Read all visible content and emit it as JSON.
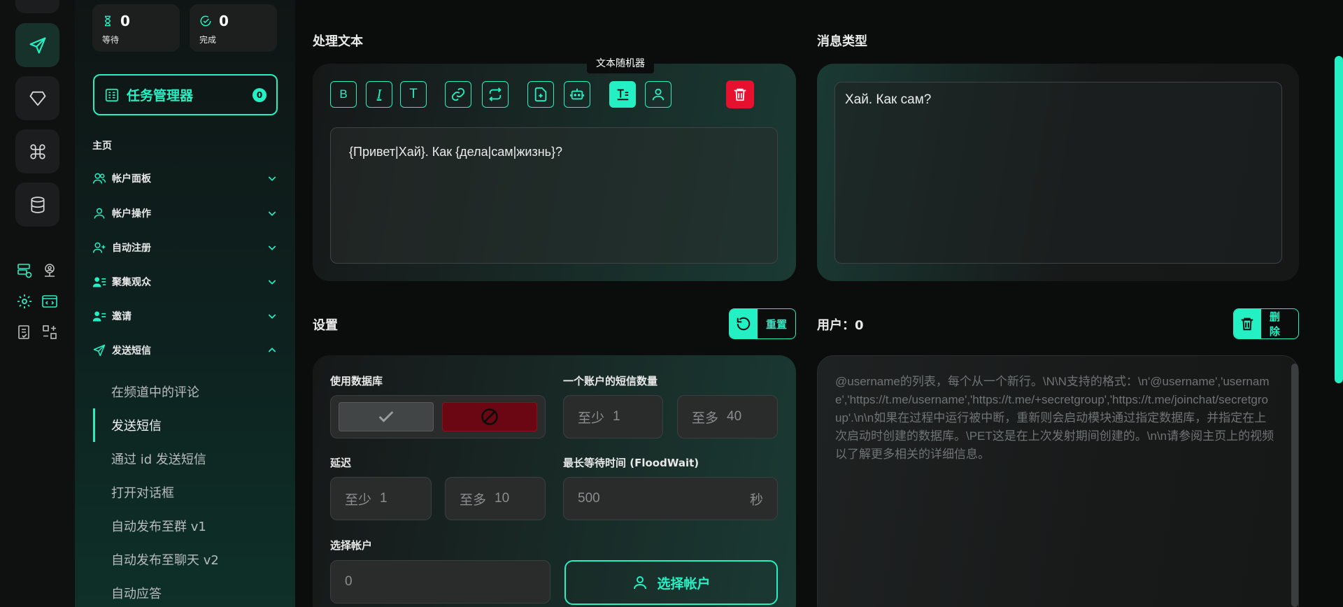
{
  "rail": {
    "icons": [
      "send-icon",
      "diamond-icon",
      "command-icon",
      "database-icon"
    ]
  },
  "stats": {
    "waiting_count": "0",
    "waiting_label": "等待",
    "done_count": "0",
    "done_label": "完成"
  },
  "task_manager": {
    "label": "任务管理器",
    "count": "0"
  },
  "nav": {
    "home": "主页",
    "items": [
      {
        "label": "帐户面板"
      },
      {
        "label": "帐户操作"
      },
      {
        "label": "自动注册"
      },
      {
        "label": "聚集观众"
      },
      {
        "label": "邀请"
      },
      {
        "label": "发送短信"
      }
    ],
    "sub_items": [
      {
        "label": "在频道中的评论"
      },
      {
        "label": "发送短信"
      },
      {
        "label": "通过 id 发送短信"
      },
      {
        "label": "打开对话框"
      },
      {
        "label": "自动发布至群 v1"
      },
      {
        "label": "自动发布至聊天 v2"
      },
      {
        "label": "自动应答"
      }
    ]
  },
  "process_text": {
    "title": "处理文本",
    "tooltip": "文本随机器",
    "content": "{Привет|Хай}. Как {дела|сам|жизнь}?"
  },
  "message_type": {
    "title": "消息类型",
    "content": "Хай. Как сам?"
  },
  "settings": {
    "title": "设置",
    "reset_label": "重置",
    "use_db_label": "使用数据库",
    "sms_count_label": "一个账户的短信数量",
    "sms_min_placeholder": "至少",
    "sms_min_value": "1",
    "sms_max_placeholder": "至多",
    "sms_max_value": "40",
    "delay_label": "延迟",
    "delay_min_placeholder": "至少",
    "delay_min_value": "1",
    "delay_max_placeholder": "至多",
    "delay_max_value": "10",
    "floodwait_label": "最长等待时间 (FloodWait)",
    "floodwait_value": "500",
    "floodwait_unit": "秒",
    "select_account_label": "选择帐户",
    "select_account_value": "0",
    "select_account_button": "选择帐户"
  },
  "users": {
    "title": "用户：0",
    "delete_label": "删除",
    "placeholder": "@username的列表，每个从一个新行。\\N\\N支持的格式：\\n'@username','username','https://t.me/username','https://t.me/+secretgroup','https://t.me/joinchat/secretgroup'.\\n\\n如果在过程中运行被中断，重新则会启动模块通过指定数据库，并指定在上次启动时创建的数据库。\\PET这是在上次发射期间创建的。\\n\\n请参阅主页上的视频以了解更多相关的详细信息。"
  },
  "colors": {
    "accent": "#25f0c4",
    "danger": "#e5112f",
    "background": "#0b0c0c"
  }
}
